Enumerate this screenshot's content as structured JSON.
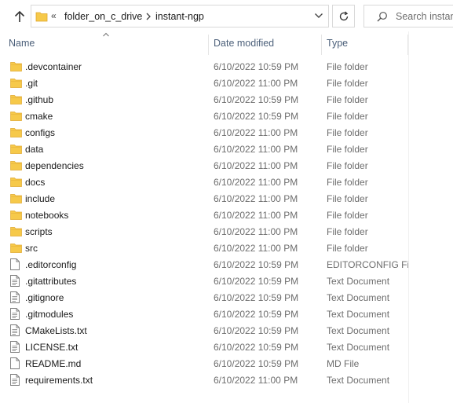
{
  "address": {
    "overflow_glyph": "«",
    "breadcrumbs": [
      "folder_on_c_drive",
      "instant-ngp"
    ]
  },
  "search": {
    "placeholder": "Search instant-ngp"
  },
  "columns": {
    "name": "Name",
    "date": "Date modified",
    "type": "Type"
  },
  "colors": {
    "folder": "#f6c94a",
    "folder_dark": "#e0a82e",
    "header_text": "#4c607a",
    "muted_text": "#6d6d6d"
  },
  "files": [
    {
      "name": ".devcontainer",
      "date": "6/10/2022 10:59 PM",
      "type": "File folder",
      "kind": "folder"
    },
    {
      "name": ".git",
      "date": "6/10/2022 11:00 PM",
      "type": "File folder",
      "kind": "folder"
    },
    {
      "name": ".github",
      "date": "6/10/2022 10:59 PM",
      "type": "File folder",
      "kind": "folder"
    },
    {
      "name": "cmake",
      "date": "6/10/2022 10:59 PM",
      "type": "File folder",
      "kind": "folder"
    },
    {
      "name": "configs",
      "date": "6/10/2022 11:00 PM",
      "type": "File folder",
      "kind": "folder"
    },
    {
      "name": "data",
      "date": "6/10/2022 11:00 PM",
      "type": "File folder",
      "kind": "folder"
    },
    {
      "name": "dependencies",
      "date": "6/10/2022 11:00 PM",
      "type": "File folder",
      "kind": "folder"
    },
    {
      "name": "docs",
      "date": "6/10/2022 11:00 PM",
      "type": "File folder",
      "kind": "folder"
    },
    {
      "name": "include",
      "date": "6/10/2022 11:00 PM",
      "type": "File folder",
      "kind": "folder"
    },
    {
      "name": "notebooks",
      "date": "6/10/2022 11:00 PM",
      "type": "File folder",
      "kind": "folder"
    },
    {
      "name": "scripts",
      "date": "6/10/2022 11:00 PM",
      "type": "File folder",
      "kind": "folder"
    },
    {
      "name": "src",
      "date": "6/10/2022 11:00 PM",
      "type": "File folder",
      "kind": "folder"
    },
    {
      "name": ".editorconfig",
      "date": "6/10/2022 10:59 PM",
      "type": "EDITORCONFIG File",
      "kind": "blank"
    },
    {
      "name": ".gitattributes",
      "date": "6/10/2022 10:59 PM",
      "type": "Text Document",
      "kind": "text"
    },
    {
      "name": ".gitignore",
      "date": "6/10/2022 10:59 PM",
      "type": "Text Document",
      "kind": "text"
    },
    {
      "name": ".gitmodules",
      "date": "6/10/2022 10:59 PM",
      "type": "Text Document",
      "kind": "text"
    },
    {
      "name": "CMakeLists.txt",
      "date": "6/10/2022 10:59 PM",
      "type": "Text Document",
      "kind": "text"
    },
    {
      "name": "LICENSE.txt",
      "date": "6/10/2022 10:59 PM",
      "type": "Text Document",
      "kind": "text"
    },
    {
      "name": "README.md",
      "date": "6/10/2022 10:59 PM",
      "type": "MD File",
      "kind": "blank"
    },
    {
      "name": "requirements.txt",
      "date": "6/10/2022 11:00 PM",
      "type": "Text Document",
      "kind": "text"
    }
  ]
}
